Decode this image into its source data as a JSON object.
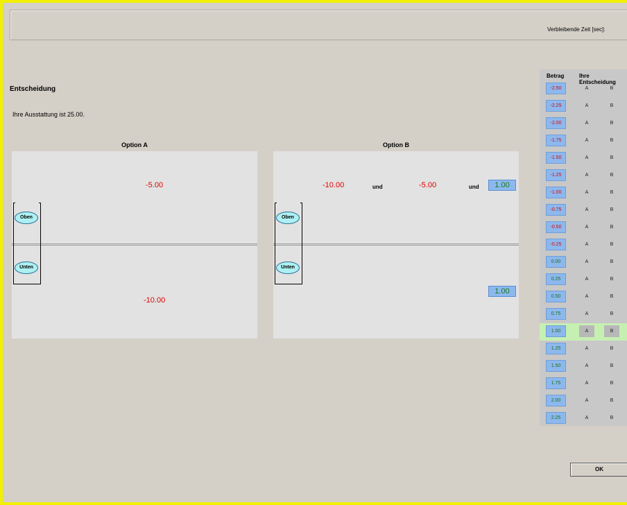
{
  "header": {
    "timer_label": "Verbleibende Zeit [sec]:"
  },
  "title": "Entscheidung",
  "endowment_text": "Ihre Ausstattung ist 25.00.",
  "option_a": {
    "title": "Option A",
    "top_value": "-5.00",
    "bottom_value": "-10.00",
    "ball_top": "Oben",
    "ball_bottom": "Unten"
  },
  "option_b": {
    "title": "Option B",
    "top_value_1": "-10.00",
    "und_1": "und",
    "top_value_2": "-5.00",
    "und_2": "und",
    "top_box": "1.00",
    "bottom_box": "1.00",
    "ball_top": "Oben",
    "ball_bottom": "Unten"
  },
  "decision_table": {
    "col_amount": "Betrag",
    "col_decision": "Ihre Entscheidung",
    "rows": [
      {
        "amount": "-2.50",
        "a": "A",
        "b": "B",
        "selected": false
      },
      {
        "amount": "-2.25",
        "a": "A",
        "b": "B",
        "selected": false
      },
      {
        "amount": "-2.00",
        "a": "A",
        "b": "B",
        "selected": false
      },
      {
        "amount": "-1.75",
        "a": "A",
        "b": "B",
        "selected": false
      },
      {
        "amount": "-1.50",
        "a": "A",
        "b": "B",
        "selected": false
      },
      {
        "amount": "-1.25",
        "a": "A",
        "b": "B",
        "selected": false
      },
      {
        "amount": "-1.00",
        "a": "A",
        "b": "B",
        "selected": false
      },
      {
        "amount": "-0.75",
        "a": "A",
        "b": "B",
        "selected": false
      },
      {
        "amount": "-0.50",
        "a": "A",
        "b": "B",
        "selected": false
      },
      {
        "amount": "-0.25",
        "a": "A",
        "b": "B",
        "selected": false
      },
      {
        "amount": "0.00",
        "a": "A",
        "b": "B",
        "selected": false
      },
      {
        "amount": "0.25",
        "a": "A",
        "b": "B",
        "selected": false
      },
      {
        "amount": "0.50",
        "a": "A",
        "b": "B",
        "selected": false
      },
      {
        "amount": "0.75",
        "a": "A",
        "b": "B",
        "selected": false
      },
      {
        "amount": "1.00",
        "a": "A",
        "b": "B",
        "selected": true
      },
      {
        "amount": "1.25",
        "a": "A",
        "b": "B",
        "selected": false
      },
      {
        "amount": "1.50",
        "a": "A",
        "b": "B",
        "selected": false
      },
      {
        "amount": "1.75",
        "a": "A",
        "b": "B",
        "selected": false
      },
      {
        "amount": "2.00",
        "a": "A",
        "b": "B",
        "selected": false
      },
      {
        "amount": "2.25",
        "a": "A",
        "b": "B",
        "selected": false
      }
    ]
  },
  "ok_label": "OK"
}
